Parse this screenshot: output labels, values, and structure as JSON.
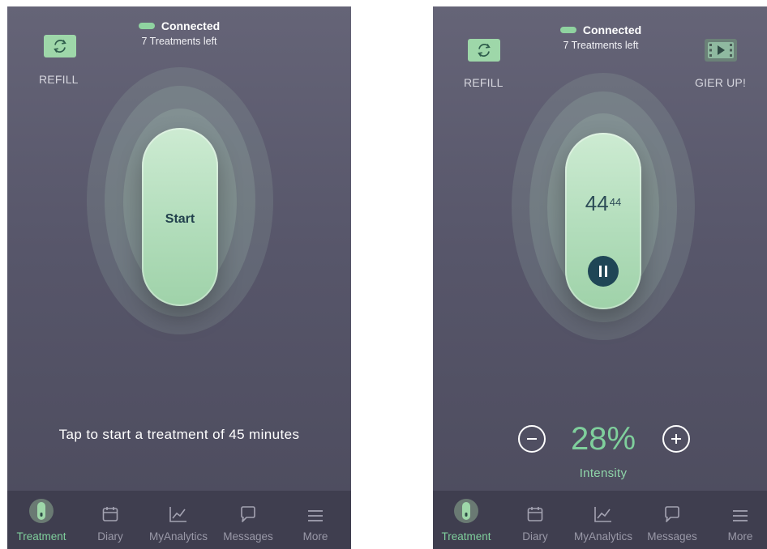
{
  "colors": {
    "accent": "#9ed7a9",
    "accent_text": "#7fcf9c",
    "dark_teal": "#1f4656",
    "tabbar_bg": "#3f3e4f"
  },
  "left": {
    "status": {
      "text": "Connected",
      "subtitle": "7 Treatments left"
    },
    "refill": {
      "label": "REFILL",
      "icon": "refresh-icon"
    },
    "start_label": "Start",
    "hint": "Tap to start a treatment of 45 minutes"
  },
  "right": {
    "status": {
      "text": "Connected",
      "subtitle": "7 Treatments left"
    },
    "refill": {
      "label": "REFILL",
      "icon": "refresh-icon"
    },
    "video": {
      "label": "GIER UP!",
      "icon": "film-play-icon"
    },
    "timer": {
      "minutes": "44",
      "seconds": "44"
    },
    "pause_icon": "pause-icon",
    "intensity": {
      "value": "28%",
      "label": "Intensity",
      "minus_icon": "minus-circle-icon",
      "plus_icon": "plus-circle-icon"
    }
  },
  "tabbar": {
    "items": [
      {
        "label": "Treatment",
        "icon": "device-icon",
        "active": true
      },
      {
        "label": "Diary",
        "icon": "calendar-icon",
        "active": false
      },
      {
        "label": "MyAnalytics",
        "icon": "chart-icon",
        "active": false
      },
      {
        "label": "Messages",
        "icon": "chat-bubble-icon",
        "active": false
      },
      {
        "label": "More",
        "icon": "menu-icon",
        "active": false
      }
    ]
  }
}
